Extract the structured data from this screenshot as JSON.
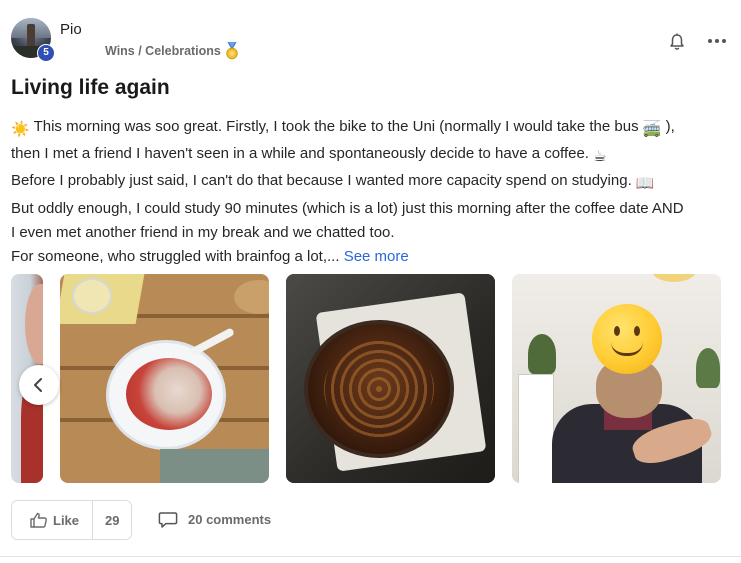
{
  "post": {
    "author": "Pio",
    "level": "5",
    "category": "Wins / Celebrations",
    "title": "Living life again",
    "body_lines": [
      {
        "pre": "",
        "text": " This morning was soo great. Firstly, I took the bike to the Uni (normally I would take the bus ",
        "post": " ),"
      },
      {
        "text": "then I met a friend I haven't seen in a while and spontaneously decide to have a coffee. "
      },
      {
        "text": "Before I probably just said, I can't do that because I wanted more capacity spend on studying. "
      },
      {
        "text": "But oddly enough, I could study 90 minutes (which is a lot) just this morning after the coffee date AND"
      },
      {
        "text": "I even met another friend in my break and we chatted too."
      },
      {
        "text": "For someone, who struggled with brainfog a lot,... "
      }
    ],
    "see_more": "See more",
    "icons": {
      "emoji_sun": "☀️",
      "emoji_bus": "🚎",
      "emoji_coffee": "☕",
      "emoji_book": "📖"
    }
  },
  "gallery": {
    "images": [
      {
        "name": "partial-portrait"
      },
      {
        "name": "strawberry-dessert"
      },
      {
        "name": "tart-in-box"
      },
      {
        "name": "selfie-smiley"
      }
    ]
  },
  "actions": {
    "like_label": "Like",
    "like_count": "29",
    "comments_label": "20 comments"
  },
  "colors": {
    "link": "#2b66d8",
    "level_badge": "#2f4fb5",
    "muted_text": "#6b6b6b"
  }
}
